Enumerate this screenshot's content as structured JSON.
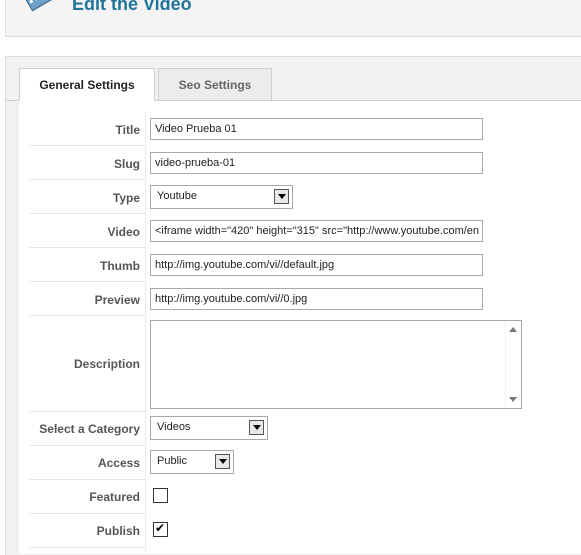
{
  "page": {
    "title": "Edit the Video"
  },
  "tabs": [
    {
      "label": "General Settings",
      "active": true
    },
    {
      "label": "Seo Settings",
      "active": false
    }
  ],
  "form": {
    "title": {
      "label": "Title",
      "value": "Video Prueba 01"
    },
    "slug": {
      "label": "Slug",
      "value": "video-prueba-01"
    },
    "type": {
      "label": "Type",
      "value": "Youtube"
    },
    "video": {
      "label": "Video",
      "value": "<iframe width=\"420\" height=\"315\" src=\"http://www.youtube.com/en"
    },
    "thumb": {
      "label": "Thumb",
      "value": "http://img.youtube.com/vi//default.jpg"
    },
    "preview": {
      "label": "Preview",
      "value": "http://img.youtube.com/vi//0.jpg"
    },
    "description": {
      "label": "Description",
      "value": ""
    },
    "category": {
      "label": "Select a Category",
      "value": "Videos"
    },
    "access": {
      "label": "Access",
      "value": "Public"
    },
    "featured": {
      "label": "Featured",
      "checked": false
    },
    "publish": {
      "label": "Publish",
      "checked": true
    }
  },
  "icons": {
    "header": "video-film-icon"
  },
  "colors": {
    "accent": "#21759b"
  }
}
